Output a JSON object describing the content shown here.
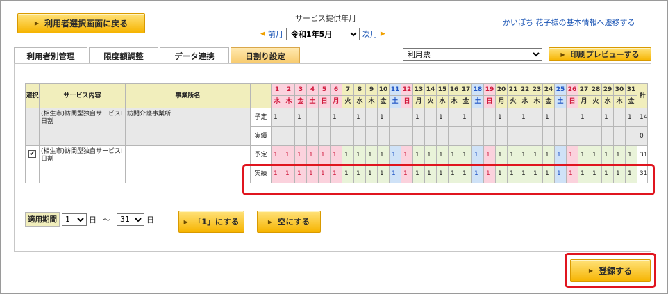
{
  "header": {
    "back_button": "利用者選択画面に戻る",
    "service_month_label": "サービス提供年月",
    "prev_label": "前月",
    "next_label": "次月",
    "month_value": "令和1年5月",
    "basic_info_link": "かいぽち 花子様の基本情報へ遷移する"
  },
  "tabs": [
    {
      "label": "利用者別管理",
      "active": false
    },
    {
      "label": "限度額調整",
      "active": false
    },
    {
      "label": "データ連携",
      "active": false
    },
    {
      "label": "日割り設定",
      "active": true
    }
  ],
  "toolbar": {
    "form_select_value": "利用票",
    "print_preview_button": "印刷プレビューする"
  },
  "grid": {
    "col_select": "選択",
    "col_service": "サービス内容",
    "col_provider": "事業所名",
    "col_total": "計",
    "days": [
      {
        "d": "1",
        "w": "水",
        "t": "sun"
      },
      {
        "d": "2",
        "w": "木",
        "t": "sun"
      },
      {
        "d": "3",
        "w": "金",
        "t": "sun"
      },
      {
        "d": "4",
        "w": "土",
        "t": "sun"
      },
      {
        "d": "5",
        "w": "日",
        "t": "sun"
      },
      {
        "d": "6",
        "w": "月",
        "t": "sun"
      },
      {
        "d": "7",
        "w": "火",
        "t": "wk"
      },
      {
        "d": "8",
        "w": "水",
        "t": "wk"
      },
      {
        "d": "9",
        "w": "木",
        "t": "wk"
      },
      {
        "d": "10",
        "w": "金",
        "t": "wk"
      },
      {
        "d": "11",
        "w": "土",
        "t": "sat"
      },
      {
        "d": "12",
        "w": "日",
        "t": "sun"
      },
      {
        "d": "13",
        "w": "月",
        "t": "wk"
      },
      {
        "d": "14",
        "w": "火",
        "t": "wk"
      },
      {
        "d": "15",
        "w": "水",
        "t": "wk"
      },
      {
        "d": "16",
        "w": "木",
        "t": "wk"
      },
      {
        "d": "17",
        "w": "金",
        "t": "wk"
      },
      {
        "d": "18",
        "w": "土",
        "t": "sat"
      },
      {
        "d": "19",
        "w": "日",
        "t": "sun"
      },
      {
        "d": "20",
        "w": "月",
        "t": "wk"
      },
      {
        "d": "21",
        "w": "火",
        "t": "wk"
      },
      {
        "d": "22",
        "w": "水",
        "t": "wk"
      },
      {
        "d": "23",
        "w": "木",
        "t": "wk"
      },
      {
        "d": "24",
        "w": "金",
        "t": "wk"
      },
      {
        "d": "25",
        "w": "土",
        "t": "sat"
      },
      {
        "d": "26",
        "w": "日",
        "t": "sun"
      },
      {
        "d": "27",
        "w": "月",
        "t": "wk"
      },
      {
        "d": "28",
        "w": "火",
        "t": "wk"
      },
      {
        "d": "29",
        "w": "水",
        "t": "wk"
      },
      {
        "d": "30",
        "w": "木",
        "t": "wk"
      },
      {
        "d": "31",
        "w": "金",
        "t": "wk"
      }
    ],
    "rows": [
      {
        "checked": false,
        "service": "(相生市)訪問型独自サービスⅠ日割",
        "provider": "訪問介護事業所",
        "plan_label": "予定",
        "actual_label": "実績",
        "plan": [
          "1",
          "",
          "1",
          "",
          "",
          "1",
          "",
          "1",
          "",
          "1",
          "",
          "",
          "1",
          "",
          "1",
          "",
          "1",
          "",
          "",
          "1",
          "",
          "1",
          "",
          "1",
          "",
          "",
          "1",
          "",
          "1",
          "",
          "1"
        ],
        "plan_total": "14",
        "actual": [
          "",
          "",
          "",
          "",
          "",
          "",
          "",
          "",
          "",
          "",
          "",
          "",
          "",
          "",
          "",
          "",
          "",
          "",
          "",
          "",
          "",
          "",
          "",
          "",
          "",
          "",
          "",
          "",
          "",
          "",
          ""
        ],
        "actual_total": "0"
      },
      {
        "checked": true,
        "service": "(相生市)訪問型独自サービスⅠ日割",
        "provider": "",
        "plan_label": "予定",
        "actual_label": "実績",
        "plan": [
          "1",
          "1",
          "1",
          "1",
          "1",
          "1",
          "1",
          "1",
          "1",
          "1",
          "1",
          "1",
          "1",
          "1",
          "1",
          "1",
          "1",
          "1",
          "1",
          "1",
          "1",
          "1",
          "1",
          "1",
          "1",
          "1",
          "1",
          "1",
          "1",
          "1",
          "1"
        ],
        "plan_total": "31",
        "actual": [
          "1",
          "1",
          "1",
          "1",
          "1",
          "1",
          "1",
          "1",
          "1",
          "1",
          "1",
          "1",
          "1",
          "1",
          "1",
          "1",
          "1",
          "1",
          "1",
          "1",
          "1",
          "1",
          "1",
          "1",
          "1",
          "1",
          "1",
          "1",
          "1",
          "1",
          "1"
        ],
        "actual_total": "31"
      }
    ]
  },
  "period": {
    "label": "適用期間",
    "from_value": "1",
    "from_unit": "日",
    "tilde": "～",
    "to_value": "31",
    "to_unit": "日",
    "set_one_button": "「1」にする",
    "clear_button": "空にする"
  },
  "footer": {
    "register_button": "登録する"
  },
  "colors": {
    "accent_yellow": "#f6b400",
    "highlight_red": "#e0151f",
    "sunday_pink": "#fbd2dd",
    "saturday_blue": "#cfe2f7",
    "weekday_green": "#e9f3d9"
  }
}
